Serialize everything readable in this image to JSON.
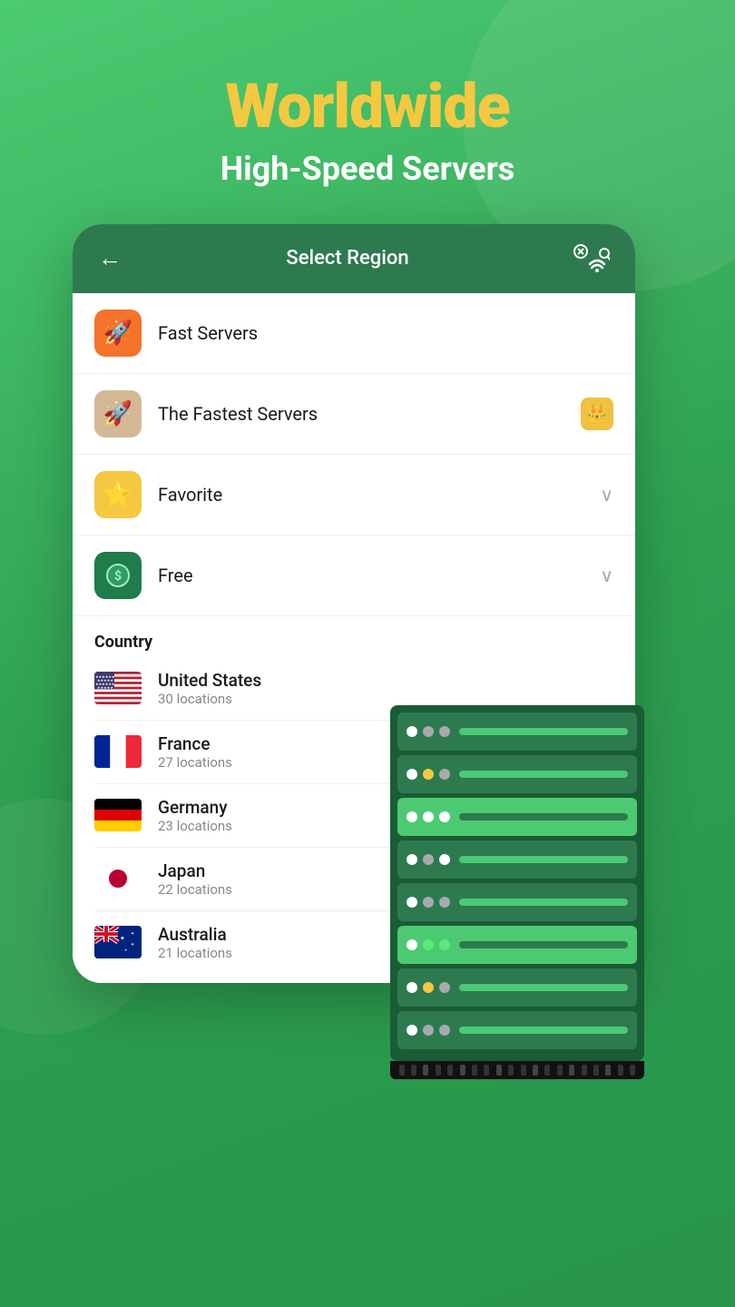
{
  "header": {
    "title": "Worldwide",
    "subtitle": "High-Speed Servers"
  },
  "phone": {
    "navbar": {
      "back_label": "←",
      "title": "Select Region"
    },
    "menu_items": [
      {
        "id": "fast-servers",
        "icon_type": "orange",
        "icon": "🚀",
        "label": "Fast Servers",
        "right": ""
      },
      {
        "id": "fastest-servers",
        "icon_type": "tan",
        "icon": "🚀",
        "label": "The Fastest Servers",
        "right": "crown"
      },
      {
        "id": "favorite",
        "icon_type": "yellow",
        "icon": "⭐",
        "label": "Favorite",
        "right": "chevron"
      },
      {
        "id": "free",
        "icon_type": "green",
        "icon": "$",
        "label": "Free",
        "right": "chevron"
      }
    ],
    "country_section_label": "Country",
    "countries": [
      {
        "id": "us",
        "name": "United States",
        "locations": "30 locations",
        "flag": "us"
      },
      {
        "id": "fr",
        "name": "France",
        "locations": "27 locations",
        "flag": "fr"
      },
      {
        "id": "de",
        "name": "Germany",
        "locations": "23 locations",
        "flag": "de"
      },
      {
        "id": "jp",
        "name": "Japan",
        "locations": "22 locations",
        "flag": "jp"
      },
      {
        "id": "au",
        "name": "Australia",
        "locations": "21 locations",
        "flag": "au"
      }
    ]
  },
  "icons": {
    "back": "←",
    "chevron_down": "∨",
    "crown": "👑"
  }
}
